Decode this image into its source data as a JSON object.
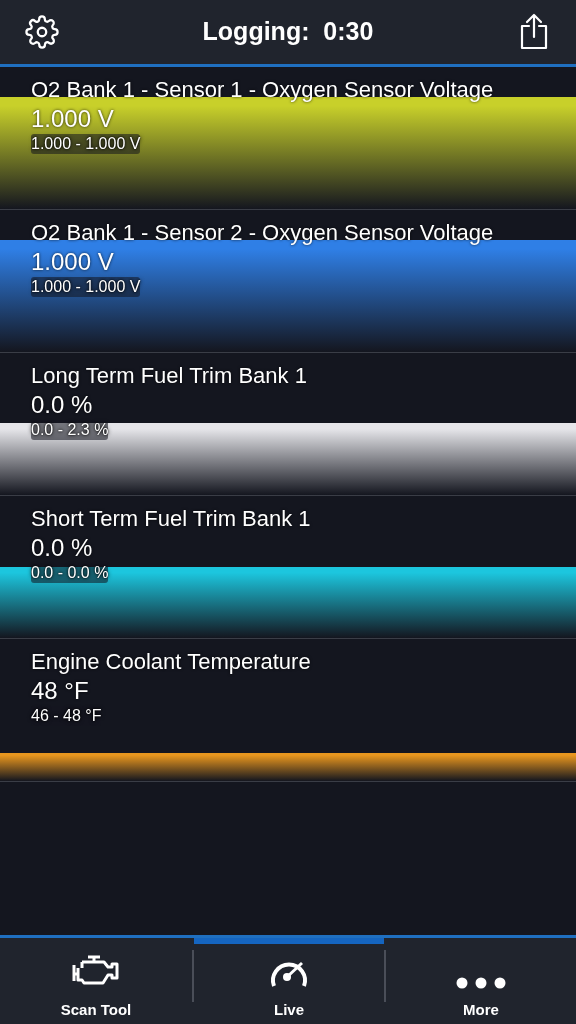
{
  "header": {
    "title": "Logging:  0:30"
  },
  "sensors": [
    {
      "name": "O2 Bank 1 - Sensor 1 - Oxygen Sensor Voltage",
      "value": "1.000 V",
      "range": "1.000 - 1.000 V",
      "color": "#c8d02a"
    },
    {
      "name": "O2 Bank 1 - Sensor 2 - Oxygen Sensor Voltage",
      "value": "1.000 V",
      "range": "1.000 - 1.000 V",
      "color": "#2f7fe6"
    },
    {
      "name": "Long Term Fuel Trim Bank 1",
      "value": "0.0 %",
      "range": "0.0 - 2.3 %",
      "color": "#e6e6ea"
    },
    {
      "name": "Short Term Fuel Trim Bank 1",
      "value": "0.0 %",
      "range": "0.0 - 0.0 %",
      "color": "#1cc6de"
    },
    {
      "name": "Engine Coolant Temperature",
      "value": "48 °F",
      "range": "46 - 48 °F",
      "color": "#e8961e"
    }
  ],
  "tabs": [
    {
      "label": "Scan Tool",
      "kind": "engine",
      "selected": false
    },
    {
      "label": "Live",
      "kind": "gauge",
      "selected": true
    },
    {
      "label": "More",
      "kind": "more",
      "selected": false
    }
  ]
}
